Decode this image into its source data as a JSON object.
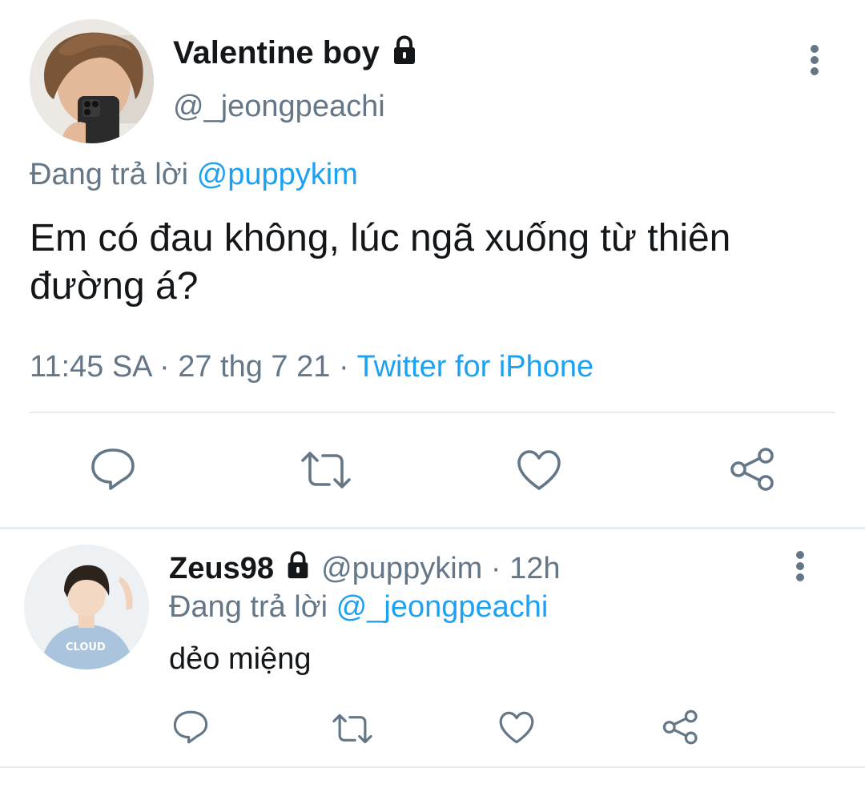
{
  "main_tweet": {
    "display_name": "Valentine boy",
    "handle": "@_jeongpeachi",
    "replying_prefix": "Đang trả lời ",
    "replying_to": "@puppykim",
    "text": "Em có đau không, lúc ngã xuống từ thiên đường á?",
    "time": "11:45 SA",
    "date": "27 thg 7 21",
    "separator": " · ",
    "source": "Twitter for iPhone",
    "avatar_icon": "avatar-photo",
    "lock_icon": "lock-icon",
    "more_icon": "more-vertical-icon"
  },
  "actions": {
    "reply_icon": "reply-icon",
    "retweet_icon": "retweet-icon",
    "like_icon": "heart-icon",
    "share_icon": "share-icon"
  },
  "reply_tweet": {
    "display_name": "Zeus98",
    "handle": "@puppykim",
    "separator": " · ",
    "time_ago": "12h",
    "replying_prefix": "Đang trả lời ",
    "replying_to": "@_jeongpeachi",
    "text": "dẻo miệng",
    "avatar_icon": "avatar-photo",
    "lock_icon": "lock-icon",
    "more_icon": "more-vertical-icon"
  },
  "colors": {
    "text_primary": "#14171a",
    "text_secondary": "#657786",
    "link": "#1da1f2",
    "icon": "#657786",
    "divider": "#e6ecf0"
  }
}
